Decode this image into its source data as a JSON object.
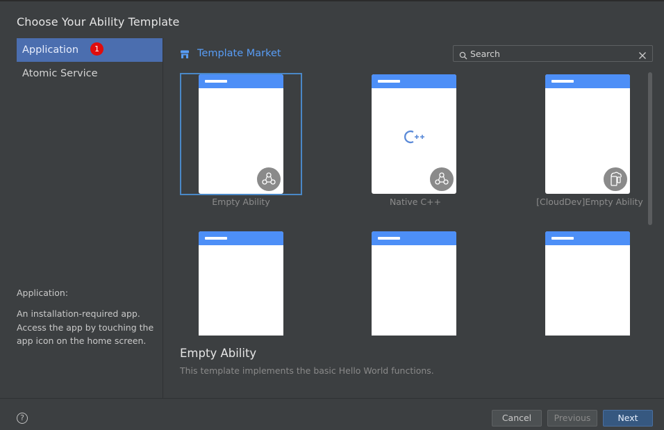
{
  "dialog": {
    "title": "Choose Your Ability Template"
  },
  "sidebar": {
    "items": [
      {
        "label": "Application",
        "badge": "1",
        "active": true
      },
      {
        "label": "Atomic Service",
        "active": false
      }
    ],
    "description_title": "Application:",
    "description_body": "An installation-required app. Access the app by touching the app icon on the home screen."
  },
  "market": {
    "label": "Template Market",
    "icon": "store-icon"
  },
  "search": {
    "placeholder": "Search",
    "value": ""
  },
  "templates": [
    {
      "label": "Empty Ability",
      "icon": "ability-icon",
      "selected": true
    },
    {
      "label": "Native C++",
      "icon": "ability-icon",
      "center_icon": "cpp-icon"
    },
    {
      "label": "[CloudDev]Empty Ability",
      "icon": "cloud-device-icon"
    },
    {
      "label": "",
      "icon": "ability-icon"
    },
    {
      "label": "",
      "icon": "form-icon"
    },
    {
      "label": "",
      "icon": "form-icon"
    }
  ],
  "selected_template": {
    "title": "Empty Ability",
    "description": "This template implements the basic Hello World functions."
  },
  "footer": {
    "help_icon": "question-icon",
    "cancel_label": "Cancel",
    "previous_label": "Previous",
    "next_label": "Next"
  },
  "colors": {
    "background": "#3c3f41",
    "active_sidebar": "#4b6eaf",
    "accent_blue": "#589df6",
    "phone_header": "#4d8ff7",
    "badge_red": "#e00c0c",
    "primary_button": "#365880"
  }
}
